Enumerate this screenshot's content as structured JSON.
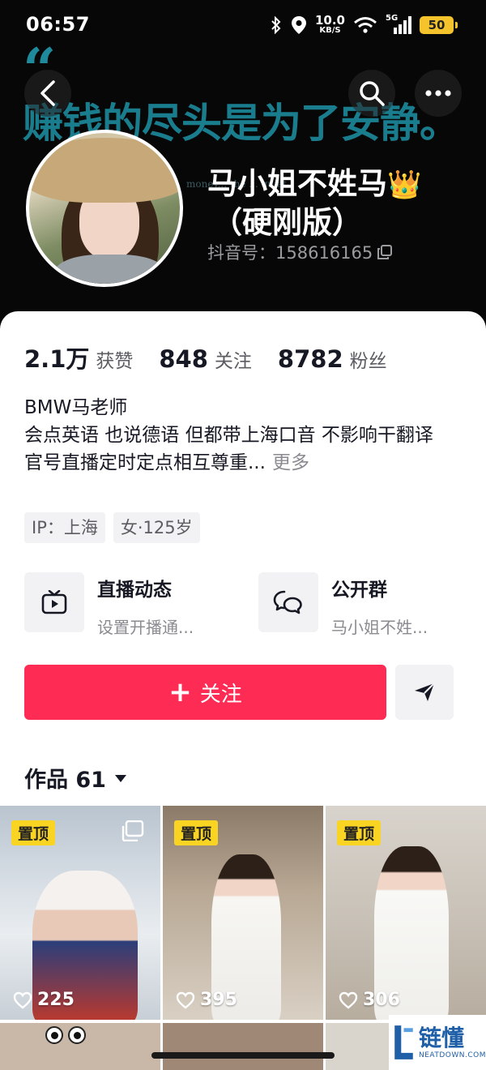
{
  "status_bar": {
    "time": "06:57",
    "net_speed_value": "10.0",
    "net_speed_unit": "KB/S",
    "network": "5G",
    "battery": "50",
    "battery_color": "#f5c32c"
  },
  "banner": {
    "quote": "“",
    "text": "赚钱的尽头是为了安静。",
    "sub_text": "money... the ... quiet"
  },
  "profile": {
    "name_line1": "马小姐不姓马",
    "crown": "👑",
    "name_line2": "（硬刚版）",
    "id_label": "抖音号：158616165"
  },
  "stats": [
    {
      "value": "2.1万",
      "label": "获赞"
    },
    {
      "value": "848",
      "label": "关注"
    },
    {
      "value": "8782",
      "label": "粉丝"
    }
  ],
  "bio": {
    "line1": "BMW马老师",
    "line2": "会点英语 也说德语 但都带上海口音 不影响干翻译",
    "line3": "官号直播定时定点相互尊重...",
    "more": "更多"
  },
  "tags": [
    "IP：上海",
    "女·125岁"
  ],
  "entries": {
    "live": {
      "title": "直播动态",
      "subtitle": "设置开播通..."
    },
    "group": {
      "title": "公开群",
      "subtitle": "马小姐不姓..."
    }
  },
  "actions": {
    "follow_plus": "+",
    "follow_label": "关注",
    "accent": "#fe2c55"
  },
  "works": {
    "label": "作品 61"
  },
  "videos": [
    {
      "badge": "置顶",
      "likes": "225"
    },
    {
      "badge": "置顶",
      "likes": "395"
    },
    {
      "badge": "置顶",
      "likes": "306"
    }
  ],
  "watermark": {
    "title": "链懂",
    "sub": "NEATDOWN.COM"
  }
}
